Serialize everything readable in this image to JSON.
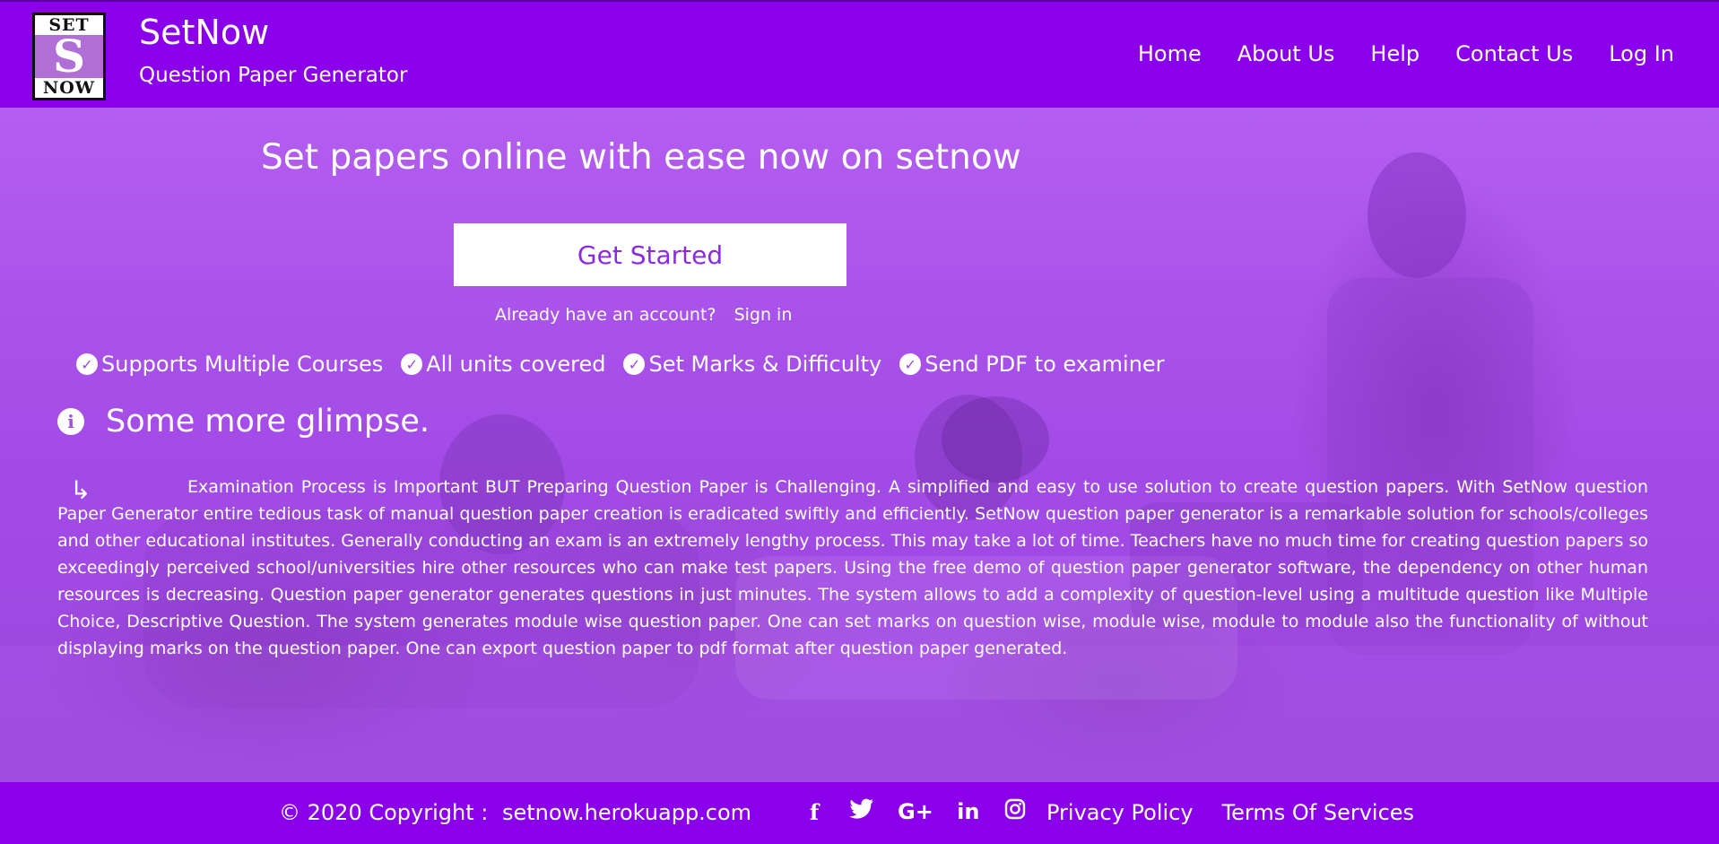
{
  "header": {
    "logo": {
      "top_text": "SET",
      "mid_text": "S",
      "bottom_text": "NOW"
    },
    "brand_name": "SetNow",
    "tagline": "Question Paper Generator",
    "nav": [
      {
        "label": "Home"
      },
      {
        "label": "About Us"
      },
      {
        "label": "Help"
      },
      {
        "label": "Contact Us"
      },
      {
        "label": "Log In"
      }
    ]
  },
  "hero": {
    "title": "Set papers online with ease now on setnow",
    "cta_label": "Get Started",
    "account_prompt": "Already have an account?",
    "signin_label": "Sign in",
    "features": [
      {
        "icon": "check-circle-icon",
        "label": "Supports Multiple Courses"
      },
      {
        "icon": "check-circle-icon",
        "label": "All units covered"
      },
      {
        "icon": "check-circle-icon",
        "label": "Set Marks & Difficulty"
      },
      {
        "icon": "check-circle-icon",
        "label": "Send PDF to examiner"
      }
    ]
  },
  "glimpse": {
    "title": "Some more glimpse.",
    "paragraph": "Examination Process is Important BUT Preparing Question Paper is Challenging. A simplified and easy to use solution to create question papers. With SetNow question Paper Generator entire tedious task of manual question paper creation is eradicated swiftly and efficiently. SetNow question paper generator is a remarkable solution for schools/colleges and other educational institutes. Generally conducting an exam is an extremely lengthy process. This may take a lot of time. Teachers have no much time for creating question papers so exceedingly perceived school/universities hire other resources who can make test papers. Using the free demo of question paper generator software, the dependency on other human resources is decreasing. Question paper generator generates questions in just minutes. The system allows to add a complexity of question-level using a multitude question like Multiple Choice, Descriptive Question. The system generates module wise question paper. One can set marks on question wise, module wise, module to module also the functionality of without displaying marks on the question paper. One can export question paper to pdf format after question paper generated."
  },
  "footer": {
    "copyright": "© 2020 Copyright :",
    "domain": "setnow.herokuapp.com",
    "social_icons": [
      "facebook-icon",
      "twitter-icon",
      "google-plus-icon",
      "linkedin-icon",
      "instagram-icon"
    ],
    "links": [
      {
        "label": "Privacy Policy"
      },
      {
        "label": "Terms Of Services"
      }
    ]
  },
  "colors": {
    "primary": "#8a00ea",
    "hero_overlay": "#a54ae8",
    "button_text": "#8a2be2"
  }
}
